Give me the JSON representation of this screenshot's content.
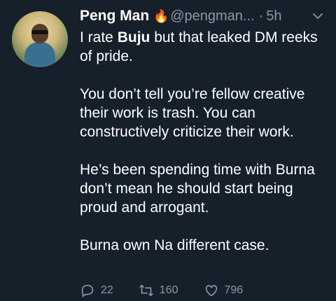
{
  "tweet": {
    "author_name": "Peng Man",
    "emoji": "🔥",
    "handle": "@pengman...",
    "separator": "·",
    "time": "5h",
    "intro": "I rate ",
    "intro_bold": "Buju",
    "intro_rest": " but that leaked DM reeks of pride.",
    "para2": "You don’t tell you’re fellow creative their work is trash. You can constructively criticize their work.",
    "para3": "He’s been spending time with Burna don’t mean he should start being proud and arrogant.",
    "para4": "Burna own Na different case."
  },
  "actions": {
    "replies": "22",
    "retweets": "160",
    "likes": "796"
  },
  "colors": {
    "background": "#15202b",
    "text": "#ffffff",
    "muted": "#8899a6"
  }
}
